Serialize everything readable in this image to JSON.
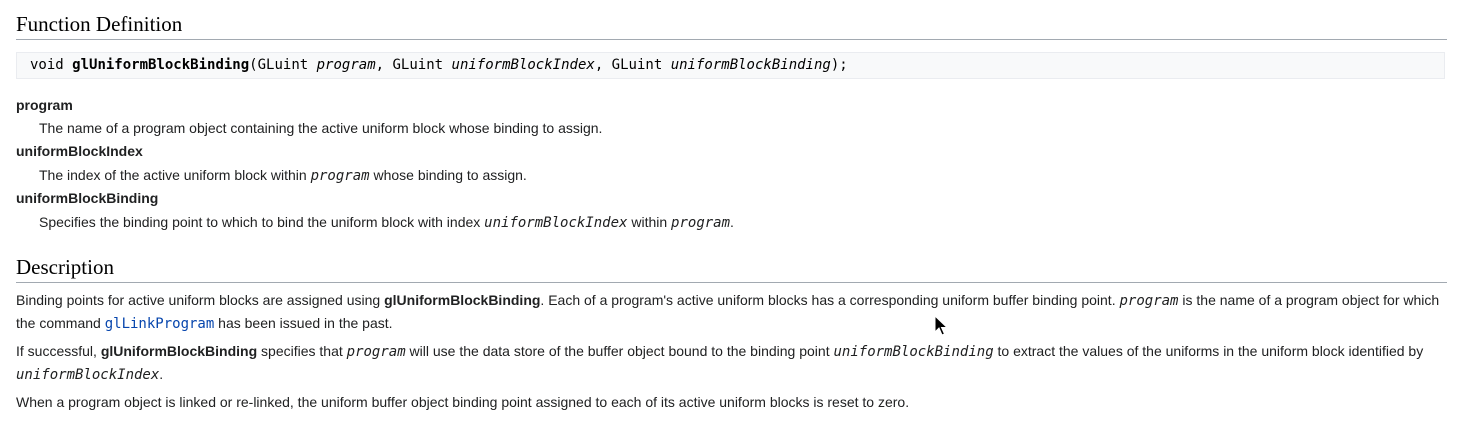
{
  "function_definition": {
    "heading": "Function Definition",
    "signature": {
      "return_type": "void",
      "name": "glUniformBlockBinding",
      "open_paren": "(",
      "param1_type": "GLuint",
      "param1_name": "program",
      "sep1": ", ",
      "param2_type": "GLuint",
      "param2_name": "uniformBlockIndex",
      "sep2": ", ",
      "param3_type": "GLuint",
      "param3_name": "uniformBlockBinding",
      "close": ");"
    },
    "params": [
      {
        "term": "program",
        "desc": "The name of a program object containing the active uniform block whose binding to assign."
      },
      {
        "term": "uniformBlockIndex",
        "desc_before": "The index of the active uniform block within ",
        "desc_code": "program",
        "desc_after": " whose binding to assign."
      },
      {
        "term": "uniformBlockBinding",
        "desc_before": "Specifies the binding point to which to bind the uniform block with index ",
        "desc_code1": "uniformBlockIndex",
        "desc_middle": " within ",
        "desc_code2": "program",
        "desc_after": "."
      }
    ]
  },
  "description": {
    "heading": "Description",
    "p1": {
      "t1": "Binding points for active uniform blocks are assigned using ",
      "b1": "glUniformBlockBinding",
      "t2": ". Each of a program's active uniform blocks has a corresponding uniform buffer binding point. ",
      "c1": "program",
      "t3": " is the name of a program object for which the command ",
      "link": "glLinkProgram",
      "t4": " has been issued in the past."
    },
    "p2": {
      "t1": "If successful, ",
      "b1": "glUniformBlockBinding",
      "t2": " specifies that ",
      "c1": "program",
      "t3": " will use the data store of the buffer object bound to the binding point ",
      "c2": "uniformBlockBinding",
      "t4": " to extract the values of the uniforms in the uniform block identified by ",
      "c3": "uniformBlockIndex",
      "t5": "."
    },
    "p3": "When a program object is linked or re-linked, the uniform buffer object binding point assigned to each of its active uniform blocks is reset to zero."
  },
  "colors": {
    "text": "#202122",
    "link": "#0645ad",
    "code_background": "#f8f9fa",
    "heading_rule": "#a2a9b1"
  },
  "icons": {
    "cursor": "mouse-pointer-icon"
  }
}
